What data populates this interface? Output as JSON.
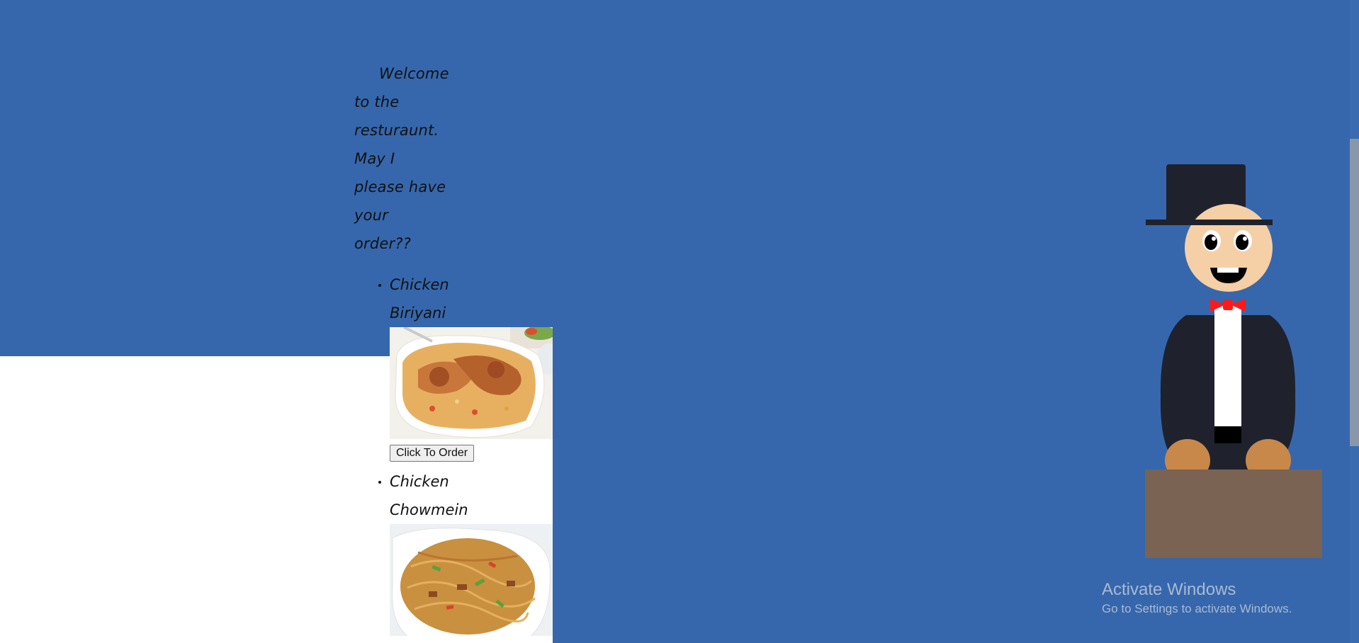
{
  "greeting": "Welcome to the resturaunt. May I please have your order??",
  "menu": {
    "items": [
      {
        "name": "Chicken Biriyani",
        "button_label": "Click To Order",
        "image_alt": "Chicken Biriyani"
      },
      {
        "name": "Chicken Chowmein",
        "image_alt": "Chicken Chowmein"
      }
    ]
  },
  "watermark": {
    "title": "Activate Windows",
    "subtitle": "Go to Settings to activate Windows."
  },
  "colors": {
    "background": "#3667ac",
    "suit": "#1f222c",
    "bowtie": "#ff1a1a",
    "podium": "#7a6352",
    "skin": "#f5cfa6"
  }
}
